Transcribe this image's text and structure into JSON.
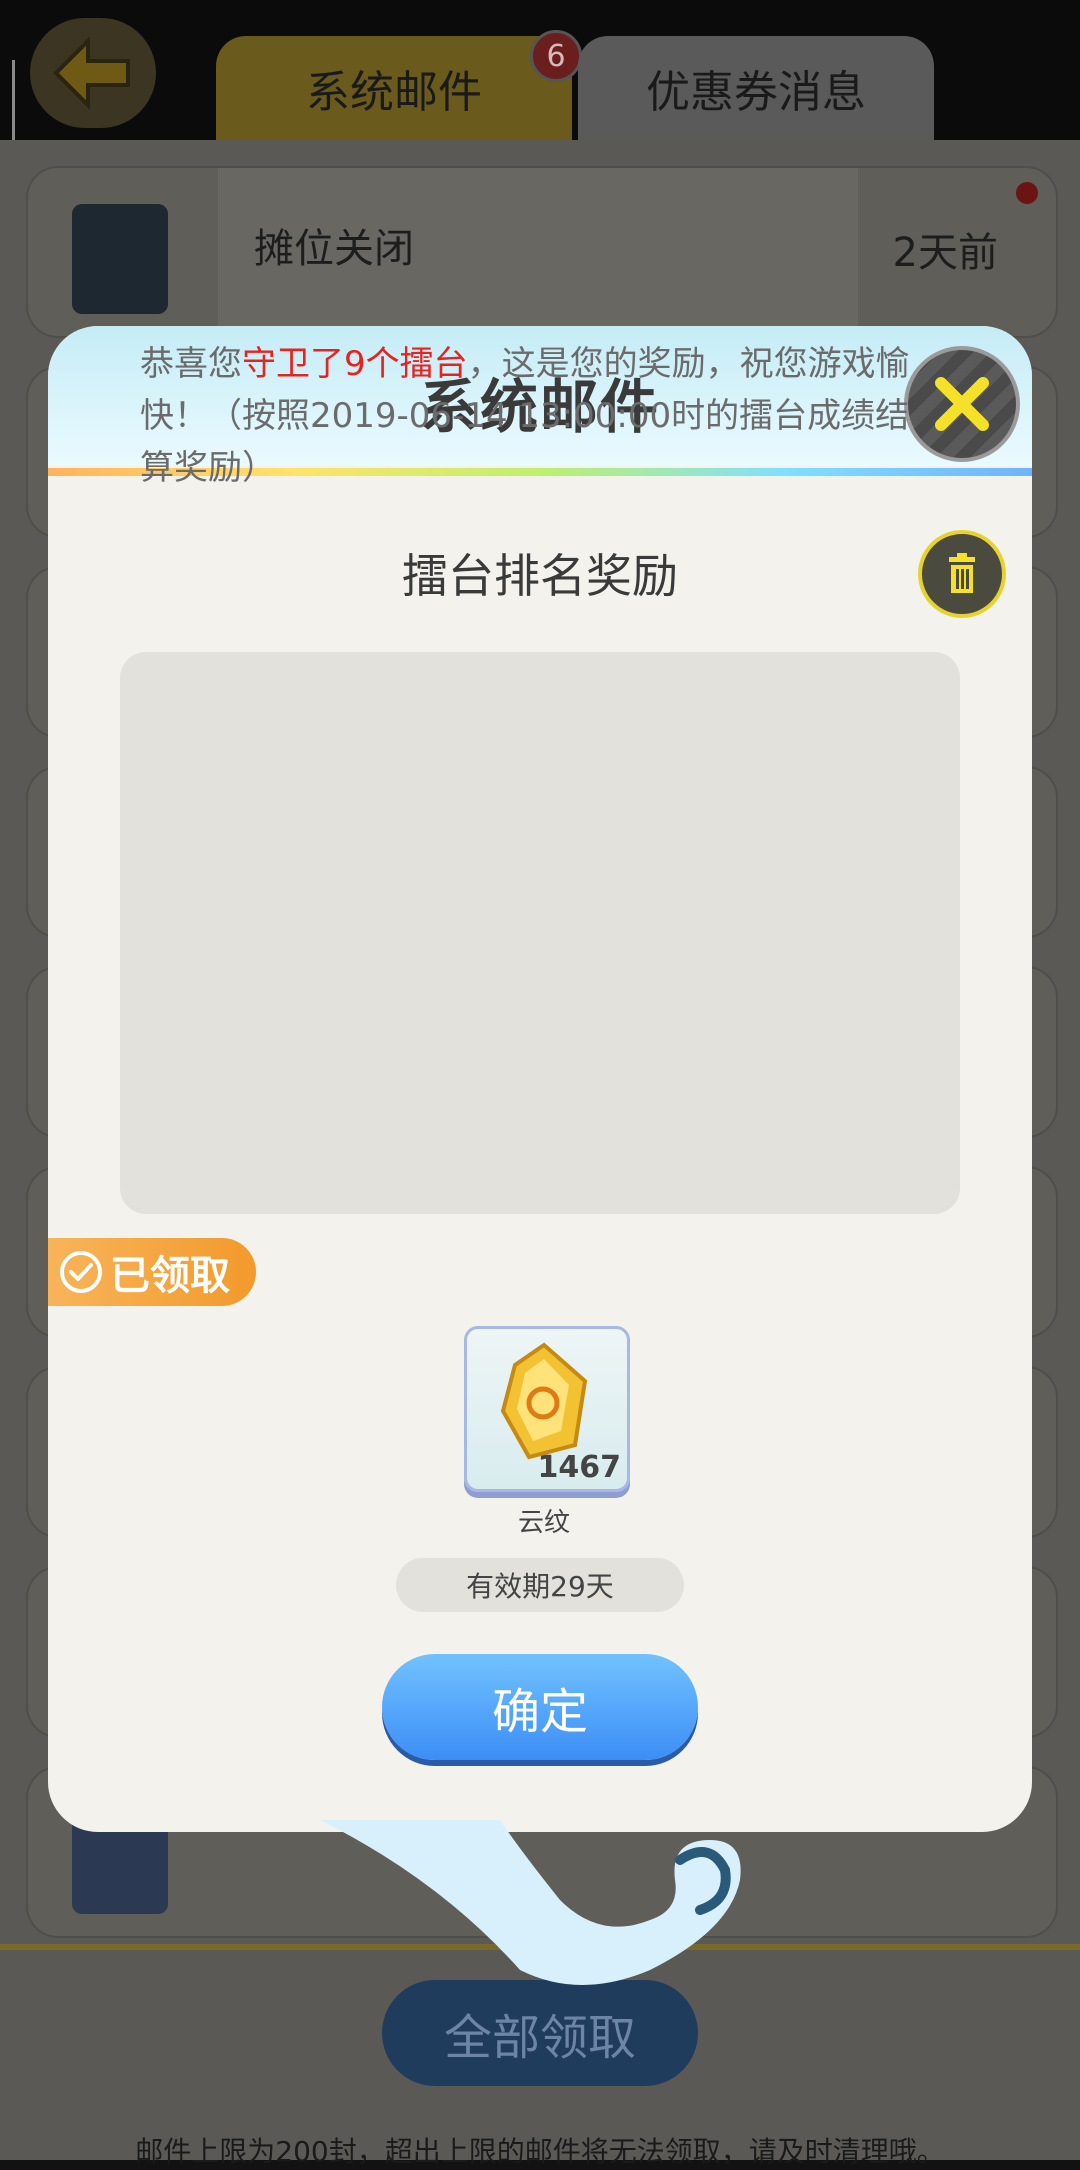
{
  "tabs": {
    "system_mail": "系统邮件",
    "system_mail_badge": "6",
    "coupon_messages": "优惠券消息"
  },
  "mail_list": [
    {
      "title": "摊位关闭",
      "time": "2天前"
    }
  ],
  "modal": {
    "title": "系统邮件",
    "subject": "擂台排名奖励",
    "message": {
      "before": "恭喜您",
      "highlight": "守卫了9个擂台",
      "after": "，这是您的奖励，祝您游戏愉快！（按照2019-06-14 13:00:00时的擂台成绩结算奖励）"
    },
    "claimed_label": "已领取",
    "reward": {
      "name": "云纹",
      "count": "1467"
    },
    "validity": "有效期29天",
    "confirm_label": "确定"
  },
  "footer": {
    "claim_all_label": "全部领取",
    "note": "邮件上限为200封，超出上限的邮件将无法领取，请及时清理哦。"
  },
  "colors": {
    "highlight_red": "#e8221e",
    "confirm_blue": "#3c8ef5",
    "claimed_orange": "#f29a2c",
    "close_yellow": "#f5e02a"
  }
}
